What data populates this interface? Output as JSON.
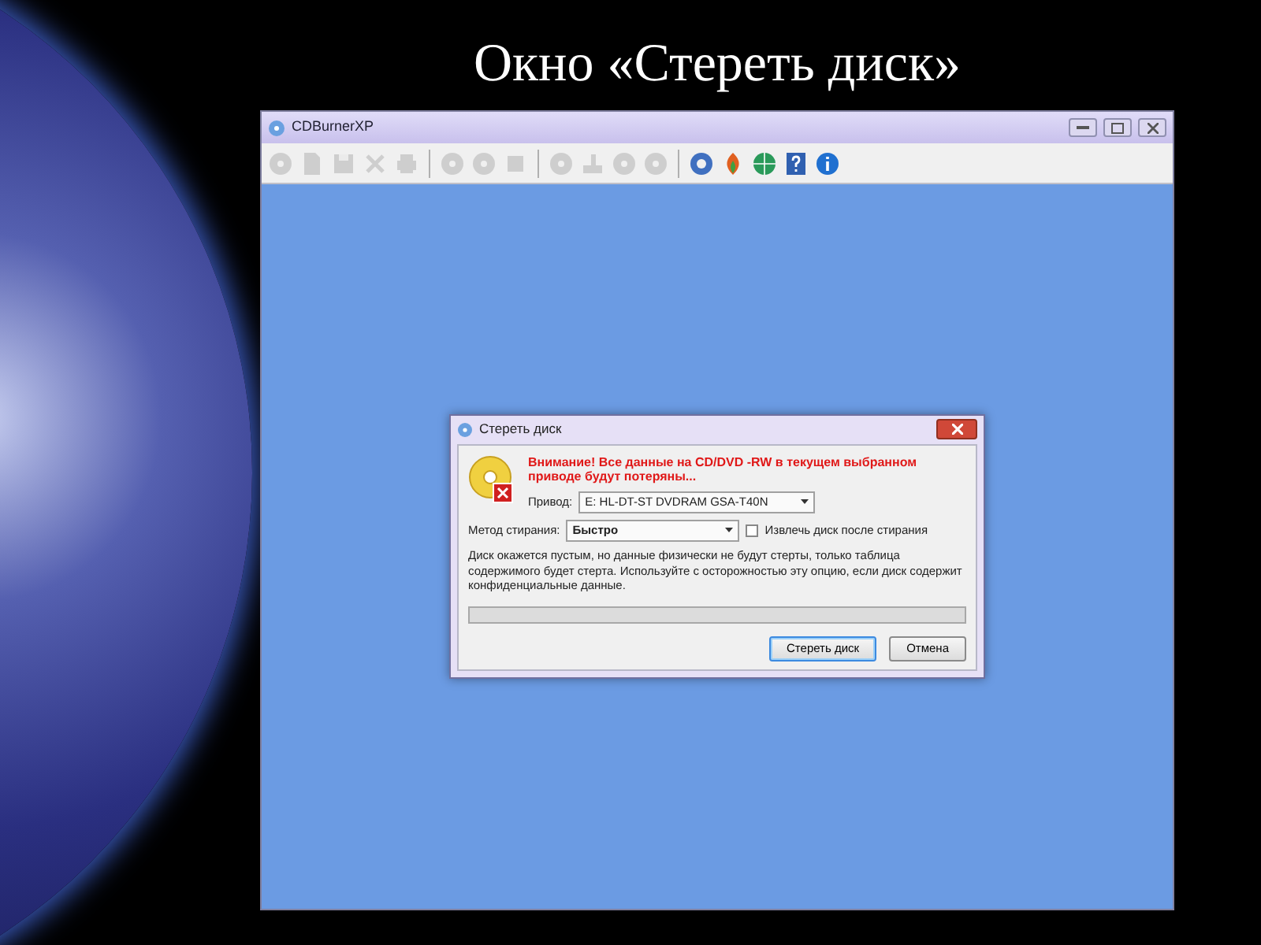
{
  "slide": {
    "title": "Окно «Стереть диск»"
  },
  "window": {
    "title": "CDBurnerXP",
    "toolbar": [
      {
        "kind": "disc",
        "disabled": true
      },
      {
        "kind": "page",
        "disabled": true
      },
      {
        "kind": "save",
        "disabled": true
      },
      {
        "kind": "cross",
        "disabled": true
      },
      {
        "kind": "printer",
        "disabled": true
      },
      {
        "kind": "separator"
      },
      {
        "kind": "disc",
        "disabled": true
      },
      {
        "kind": "disc",
        "disabled": true
      },
      {
        "kind": "square",
        "disabled": true
      },
      {
        "kind": "separator"
      },
      {
        "kind": "disc",
        "disabled": true
      },
      {
        "kind": "drive",
        "disabled": true
      },
      {
        "kind": "disc",
        "disabled": true
      },
      {
        "kind": "disc",
        "disabled": true
      },
      {
        "kind": "separator"
      },
      {
        "kind": "gear",
        "disabled": false
      },
      {
        "kind": "flame",
        "disabled": false
      },
      {
        "kind": "globe",
        "disabled": false
      },
      {
        "kind": "help",
        "disabled": false
      },
      {
        "kind": "info",
        "disabled": false
      }
    ]
  },
  "dialog": {
    "title": "Стереть диск",
    "warning": "Внимание! Все данные на CD/DVD -RW в текущем выбранном приводе будут потеряны...",
    "drive_label": "Привод:",
    "drive_value": "E: HL-DT-ST DVDRAM GSA-T40N",
    "method_label": "Метод стирания:",
    "method_value": "Быстро",
    "eject_label": "Извлечь диск после стирания",
    "eject_checked": false,
    "description": "Диск окажется пустым, но данные физически не будут стерты, только таблица содержимого будет стерта. Используйте с осторожностью эту опцию, если диск содержит конфиденциальные данные.",
    "progress": {
      "level": 0
    },
    "buttons": [
      {
        "label": "Стереть диск",
        "default": true
      },
      {
        "label": "Отмена",
        "default": false
      }
    ]
  }
}
